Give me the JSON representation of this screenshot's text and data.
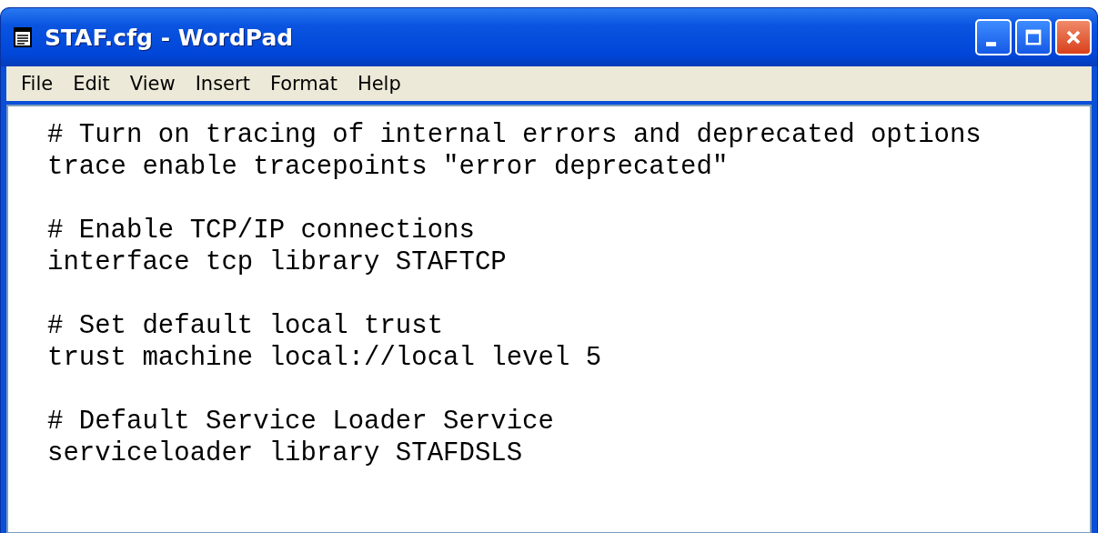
{
  "window": {
    "title": "STAF.cfg - WordPad"
  },
  "menu": [
    "File",
    "Edit",
    "View",
    "Insert",
    "Format",
    "Help"
  ],
  "document": {
    "blocks": [
      {
        "lines": [
          "# Turn on tracing of internal errors and deprecated options",
          "trace enable tracepoints \"error deprecated\""
        ]
      },
      {
        "lines": [
          "# Enable TCP/IP connections",
          "interface tcp library STAFTCP"
        ]
      },
      {
        "lines": [
          "# Set default local trust",
          "trust machine local://local level 5"
        ]
      },
      {
        "lines": [
          "# Default Service Loader Service",
          "serviceloader library STAFDSLS"
        ]
      }
    ]
  }
}
